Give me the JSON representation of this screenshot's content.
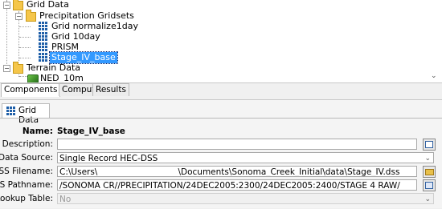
{
  "tree": {
    "nodes": [
      {
        "label": "Grid Data"
      },
      {
        "label": "Precipitation Gridsets"
      },
      {
        "label": "Grid normalize1day"
      },
      {
        "label": "Grid 10day"
      },
      {
        "label": "PRISM"
      },
      {
        "label": "Stage_IV_base"
      },
      {
        "label": "Terrain Data"
      },
      {
        "label": "NED_10m"
      }
    ]
  },
  "bottom_tabs": [
    "Components",
    "Compute",
    "Results"
  ],
  "panel": {
    "tab_label": "Grid Data",
    "name_label": "Name:",
    "name_value": "Stage_IV_base",
    "description_label": "Description:",
    "description_value": "",
    "data_source_label": "Data Source:",
    "data_source_value": "Single Record HEC-DSS",
    "dss_filename_label": "DSS Filename:",
    "dss_filename_value": "C:\\Users\\                              \\Documents\\Sonoma_Creek_Initial\\data\\Stage_IV.dss",
    "dss_pathname_label": "DSS Pathname:",
    "dss_pathname_value": "/SONOMA CR//PRECIPITATION/24DEC2005:2300/24DEC2005:2400/STAGE 4 RAW/",
    "lookup_table_label": "Lookup Table:",
    "lookup_table_value": "No",
    "required_marker": "*"
  },
  "colors": {
    "accent": "#3399ff",
    "required": "#d00000"
  }
}
